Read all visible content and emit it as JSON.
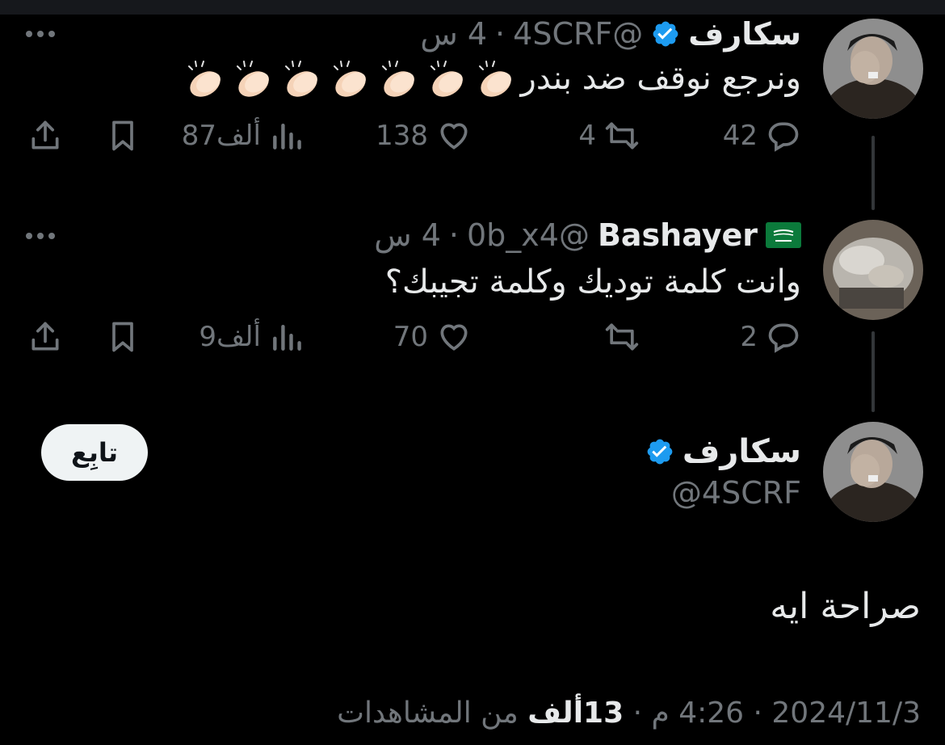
{
  "tweets": [
    {
      "name": "سكارف",
      "handle": "@4SCRF",
      "time": "4 س",
      "text": "ونرجع نوقف ضد بندر",
      "emoji_count": 7,
      "verified": true,
      "stats": {
        "replies": "42",
        "reposts": "4",
        "likes": "138",
        "views": "87ألف"
      }
    },
    {
      "name": "Bashayer",
      "handle": "@0b_x4",
      "time": "4 س",
      "text": "وانت كلمة توديك وكلمة تجيبك؟",
      "flag": "saudi-flag",
      "stats": {
        "replies": "2",
        "reposts": "",
        "likes": "70",
        "views": "9ألف"
      }
    }
  ],
  "main": {
    "name": "سكارف",
    "handle": "@4SCRF",
    "follow_label": "تابِع",
    "text": "صراحة ايه",
    "date": "2024/11/3",
    "time": "4:26 م",
    "views": "13ألف",
    "views_label": "من المشاهدات"
  },
  "colors": {
    "background": "#000000",
    "text": "#e7e9ea",
    "muted": "#71767b",
    "verified": "#1d9bf0",
    "thread_line": "#333639"
  }
}
